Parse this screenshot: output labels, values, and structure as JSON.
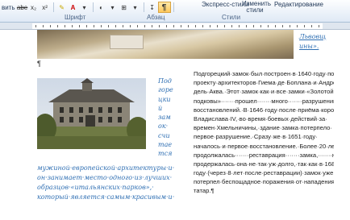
{
  "ribbon": {
    "row1": [
      {
        "name": "style-label",
        "text": "о"
      },
      {
        "name": "abc-label",
        "text": "abe"
      },
      {
        "name": "superscript-label",
        "text": "x²"
      },
      {
        "name": "font-color-label",
        "text": "A"
      },
      {
        "name": "font-size-label",
        "text": "Aa"
      }
    ],
    "groups": {
      "font": "Шрифт",
      "paragraph": "Абзац",
      "styles": "Стили",
      "editing": "Редактирование"
    },
    "express_styles": "Экспресс-стили",
    "change_styles": "Изменить стили",
    "left_fragment": "вить",
    "pilcrow": "¶"
  },
  "doc": {
    "top_right_link": [
      "Львовщ",
      "ины»."
    ],
    "left_vertical": [
      "Под",
      "горе",
      "цки",
      "й",
      "зам",
      "ок·",
      "счи",
      "тае",
      "тся"
    ],
    "left_bottom_lines": [
      "мужиной·европейской·архитектуры·и·",
      "он·занимает·место·одного·из·лучших·",
      "образцов·«итальянских·парков»,·",
      "который·является·самым·красивым·и·"
    ],
    "right_paragraph": [
      "Подгорецкий·замок·был·построен·в·1640·году·по·",
      "проекту·архитекторов·Гиема·де·Боплана·и·Андреа·",
      "дель·Аква.·Этот·замок·как·и·все·замки·«Золотой·",
      "подковы»·······прошел·······много·······разрушений·······и·",
      "восстановлений.·В·1646·году·после·приёма·короля·",
      "Владислава·IV,·во·время·боевых·действий·за·",
      "времен·Хмельничины,·здание·замка·потерпело·",
      "первое·разрушение.·Сразу·же·в·1651·году·",
      "началось·и·первое·восстановление.·Более·20·лет·",
      "продолжалась·······реставрация·······замка,·······но·",
      "продержалась·она·не·так·уж·долго,·так·как·в·1688·",
      "году·(через·8·лет·после·реставрации)·замок·уже·",
      "потерпел·беспощадное·поражения·от·нападения·",
      "татар.¶"
    ]
  }
}
